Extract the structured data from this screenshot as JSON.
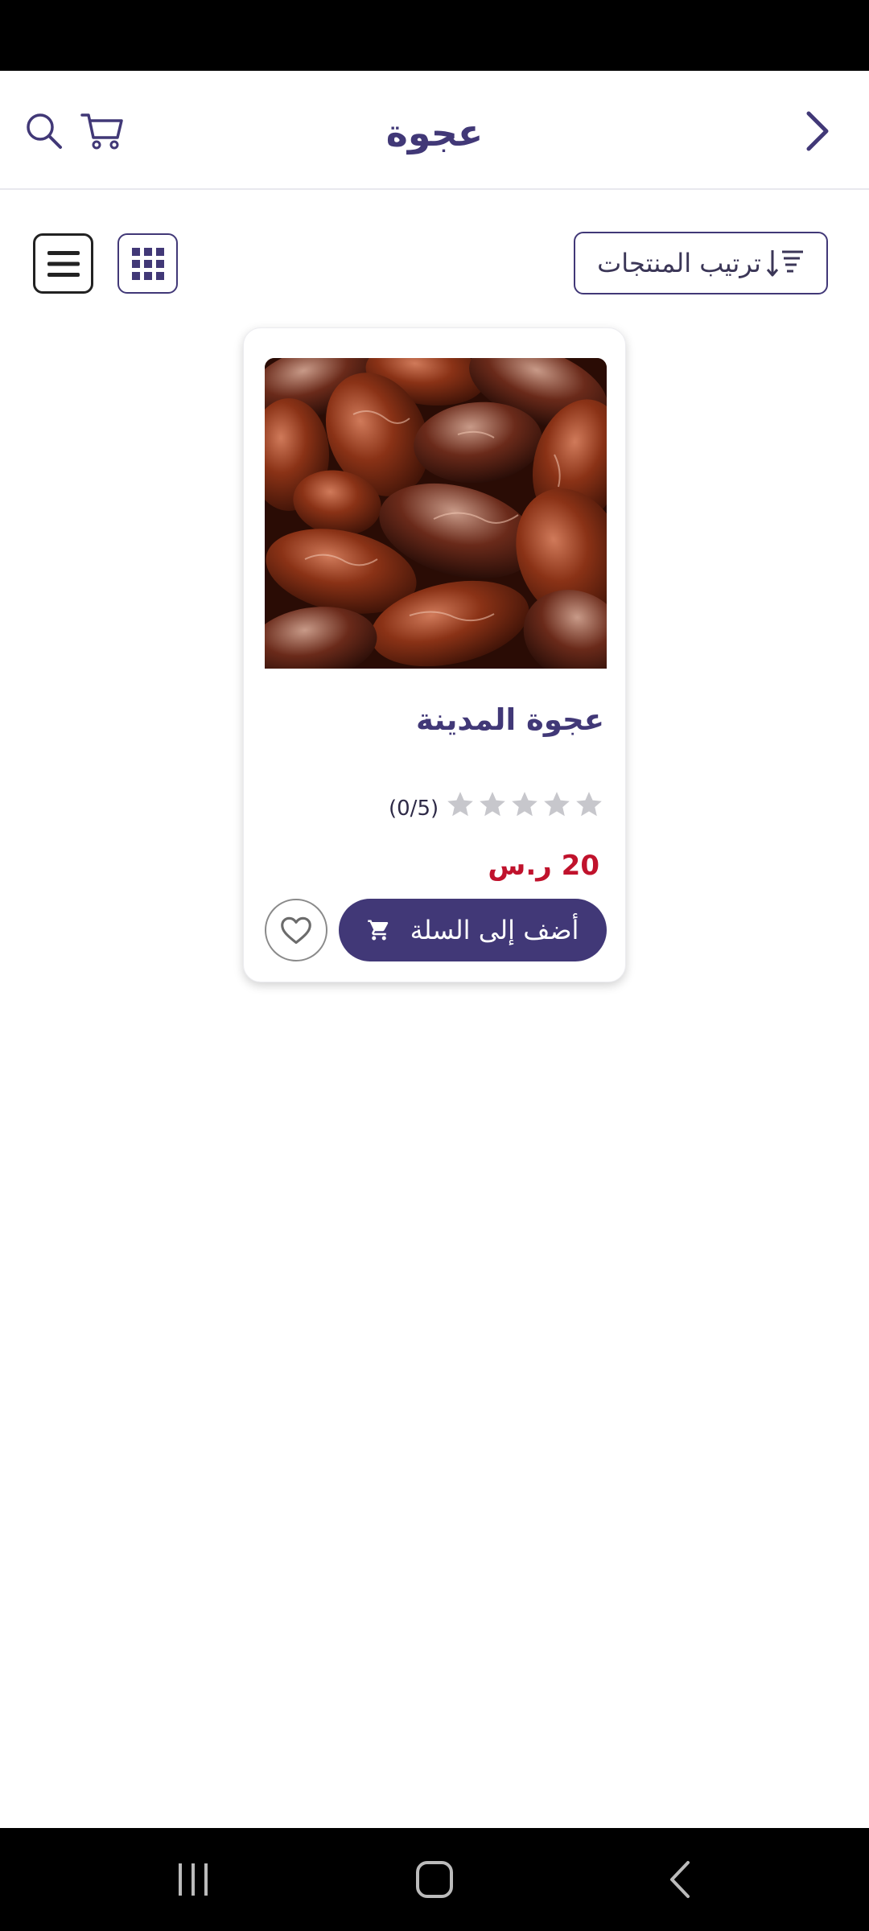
{
  "header": {
    "title": "عجوة",
    "icons": {
      "search": "search-icon",
      "cart": "cart-icon",
      "back": "chevron-right-icon"
    }
  },
  "toolbar": {
    "sort_label": "ترتيب المنتجات",
    "sort_icon": "sort-descending-icon",
    "grid_icon": "grid-view-icon",
    "list_icon": "list-view-icon"
  },
  "products": [
    {
      "name": "عجوة المدينة",
      "rating_value": 0,
      "rating_max": 5,
      "rating_text": "(0/5)",
      "price": "20 ر.س",
      "add_to_cart_label": "أضف إلى السلة",
      "cart_icon": "cart-icon",
      "wishlist_icon": "heart-icon"
    }
  ],
  "colors": {
    "primary": "#413877",
    "price": "#c0122c",
    "star_empty": "#c7c7cc"
  },
  "system_nav": {
    "recents": "recents-icon",
    "home": "home-icon",
    "back": "back-icon"
  }
}
